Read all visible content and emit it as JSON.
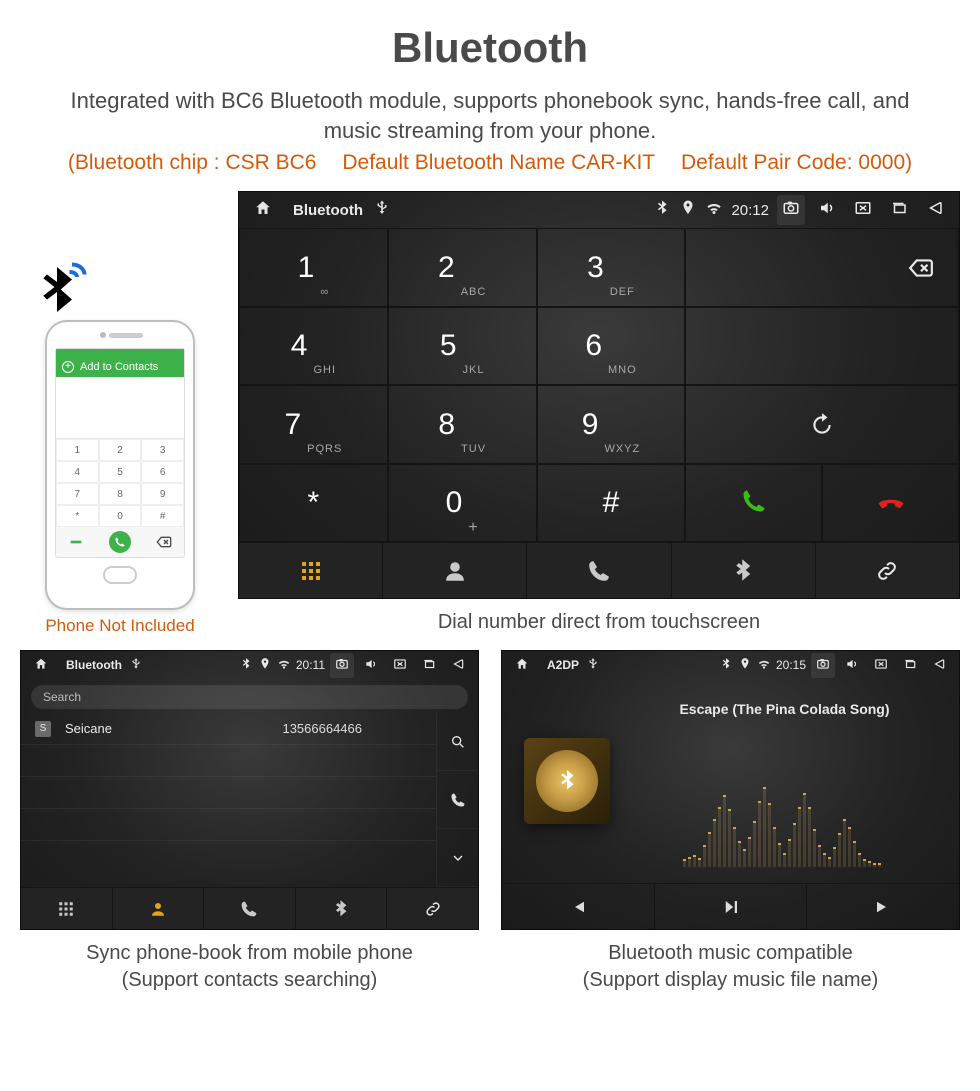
{
  "title": "Bluetooth",
  "description": "Integrated with BC6 Bluetooth module, supports phonebook sync, hands-free call, and music streaming from your phone.",
  "spec": {
    "chip": "(Bluetooth chip : CSR BC6",
    "name": "Default Bluetooth Name CAR-KIT",
    "pair": "Default Pair Code: 0000)"
  },
  "phone": {
    "add_label": "Add to Contacts",
    "pad": [
      "1",
      "2",
      "3",
      "4",
      "5",
      "6",
      "7",
      "8",
      "9",
      "*",
      "0",
      "#"
    ],
    "caption": "Phone Not Included"
  },
  "dial_unit": {
    "status": {
      "title": "Bluetooth",
      "time": "20:12"
    },
    "keys": [
      {
        "n": "1",
        "s": "∞"
      },
      {
        "n": "2",
        "s": "ABC"
      },
      {
        "n": "3",
        "s": "DEF"
      },
      {
        "n": "4",
        "s": "GHI"
      },
      {
        "n": "5",
        "s": "JKL"
      },
      {
        "n": "6",
        "s": "MNO"
      },
      {
        "n": "7",
        "s": "PQRS"
      },
      {
        "n": "8",
        "s": "TUV"
      },
      {
        "n": "9",
        "s": "WXYZ"
      },
      {
        "n": "*",
        "s": ""
      },
      {
        "n": "0",
        "s": "+"
      },
      {
        "n": "#",
        "s": ""
      }
    ],
    "caption": "Dial number direct from touchscreen"
  },
  "pb_unit": {
    "status": {
      "title": "Bluetooth",
      "time": "20:11"
    },
    "search_placeholder": "Search",
    "contact": {
      "tag": "S",
      "name": "Seicane",
      "number": "13566664466"
    },
    "caption_l1": "Sync phone-book from mobile phone",
    "caption_l2": "(Support contacts searching)"
  },
  "mu_unit": {
    "status": {
      "title": "A2DP",
      "time": "20:15"
    },
    "track": "Escape (The Pina Colada Song)",
    "caption_l1": "Bluetooth music compatible",
    "caption_l2": "(Support display music file name)"
  }
}
